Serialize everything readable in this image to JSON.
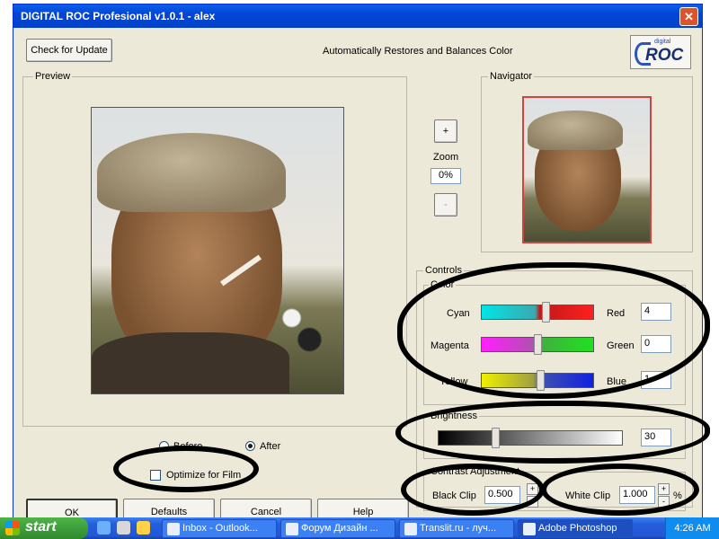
{
  "window": {
    "title": "DIGITAL ROC Profesional v1.0.1 - alex",
    "close_glyph": "✕"
  },
  "toolbar": {
    "check_update_label": "Check for Update",
    "tagline": "Automatically Restores and Balances Color",
    "logo_small": "digital",
    "logo_text": "ROC"
  },
  "preview": {
    "title": "Preview",
    "before_label": "Before",
    "after_label": "After",
    "selected": "After",
    "optimize_label": "Optimize for Film",
    "optimize_checked": false
  },
  "navigator": {
    "title": "Navigator"
  },
  "zoom": {
    "plus": "+",
    "minus": "-",
    "label": "Zoom",
    "value": "0%"
  },
  "controls": {
    "title": "Controls",
    "color": {
      "title": "Color",
      "sliders": [
        {
          "left_label": "Cyan",
          "right_label": "Red",
          "value": "4",
          "position": 0.55
        },
        {
          "left_label": "Magenta",
          "right_label": "Green",
          "value": "0",
          "position": 0.5
        },
        {
          "left_label": "Yellow",
          "right_label": "Blue",
          "value": "1",
          "position": 0.52
        }
      ]
    },
    "brightness": {
      "title": "Brightness",
      "value": "30",
      "position": 0.3
    },
    "contrast": {
      "title": "Contrast Adjustment",
      "black_clip_label": "Black Clip",
      "black_clip_value": "0.500",
      "white_clip_label": "White Clip",
      "white_clip_value": "1.000",
      "percent": "%",
      "spin_up": "+",
      "spin_down": "-"
    }
  },
  "footer": {
    "ok": "OK",
    "defaults": "Defaults",
    "cancel": "Cancel",
    "help": "Help"
  },
  "taskbar": {
    "start_label": "start",
    "tasks": [
      {
        "label": "Inbox - Outlook...",
        "active": false
      },
      {
        "label": "Форум Дизайн ...",
        "active": false
      },
      {
        "label": "Translit.ru - луч...",
        "active": false
      },
      {
        "label": "Adobe Photoshop",
        "active": true
      }
    ],
    "clock": "4:26 AM"
  },
  "colors": {
    "title_blue": "#0346d5",
    "dialog_bg": "#ece9d8",
    "close_red": "#d9542f",
    "start_green": "#3c9a39",
    "annotation": "#000000"
  }
}
